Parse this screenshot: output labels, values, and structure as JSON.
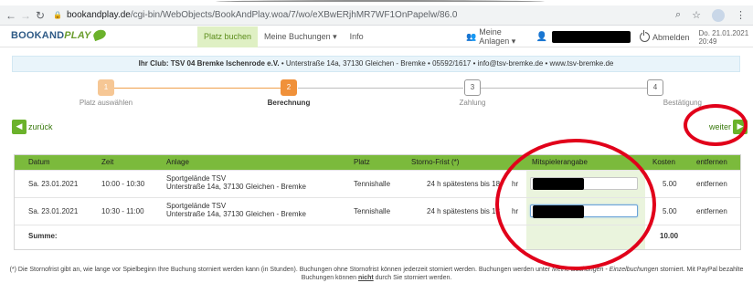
{
  "browser": {
    "url_host": "bookandplay.de",
    "url_path": "/cgi-bin/WebObjects/BookAndPlay.woa/7/wo/eXBwERjhMR7WF1OnPapelw/86.0",
    "back_icon": "arrow-left",
    "forward_icon": "arrow-right",
    "reload_icon": "reload",
    "lock_icon": "lock"
  },
  "header": {
    "logo_book": "BOOKAND",
    "logo_play": "PLAY",
    "menu": [
      {
        "label": "Platz buchen",
        "active": true
      },
      {
        "label": "Meine Buchungen ▾",
        "active": false
      },
      {
        "label": "Info",
        "active": false
      }
    ],
    "anlagen_label": "Meine Anlagen ▾",
    "logout_label": "Abmelden",
    "datetime": "Do. 21.01.2021 20:49"
  },
  "club": {
    "name": "Ihr Club: TSV 04 Bremke Ischenrode e.V.",
    "details": " • Unterstraße 14a, 37130 Gleichen - Bremke • 05592/1617 • info@tsv-bremke.de • www.tsv-bremke.de"
  },
  "steps": [
    {
      "num": "1",
      "label": "Platz auswählen",
      "state": "done"
    },
    {
      "num": "2",
      "label": "Berechnung",
      "state": "current"
    },
    {
      "num": "3",
      "label": "Zahlung",
      "state": "todo"
    },
    {
      "num": "4",
      "label": "Bestätigung",
      "state": "todo"
    }
  ],
  "nav": {
    "back_label": "zurück",
    "next_label": "weiter"
  },
  "table": {
    "headers": {
      "datum": "Datum",
      "zeit": "Zeit",
      "anlage": "Anlage",
      "platz": "Platz",
      "storno": "Storno-Frist (*)",
      "mitspieler": "Mitspielerangabe",
      "kosten": "Kosten",
      "entfernen": "entfernen"
    },
    "rows": [
      {
        "datum": "Sa. 23.01.2021",
        "zeit": "10:00 - 10:30",
        "anlage_1": "Sportgelände TSV",
        "anlage_2": "Unterstraße 14a, 37130 Gleichen - Bremke",
        "platz": "Tennishalle",
        "storno": "24 h spätestens bis 18",
        "storno_tail": "hr",
        "kosten": "5.00",
        "entfernen": "entfernen"
      },
      {
        "datum": "Sa. 23.01.2021",
        "zeit": "10:30 - 11:00",
        "anlage_1": "Sportgelände TSV",
        "anlage_2": "Unterstraße 14a, 37130 Gleichen - Bremke",
        "platz": "Tennishalle",
        "storno": "24 h spätestens bis 18",
        "storno_tail": "hr",
        "kosten": "5.00",
        "entfernen": "entfernen"
      }
    ],
    "summe_label": "Summe:",
    "summe_value": "10.00"
  },
  "footnote": {
    "part1": "(*) Die Stornofrist gibt an, wie lange vor Spielbeginn Ihre Buchung storniert werden kann (in Stunden). Buchungen ohne Stornofrist können jederzeit storniert werden. Buchungen werden unter ",
    "italic": "Meine Buchungen - Einzelbuchungen",
    "part2": " storniert. Mit PayPal bezahlte Buchungen können ",
    "emph": "nicht",
    "part3": " durch Sie storniert werden."
  },
  "colors": {
    "accent_green": "#6bb22b",
    "table_header": "#7bba3c",
    "step_orange": "#f0913a",
    "annotation_red": "#e1001a"
  }
}
